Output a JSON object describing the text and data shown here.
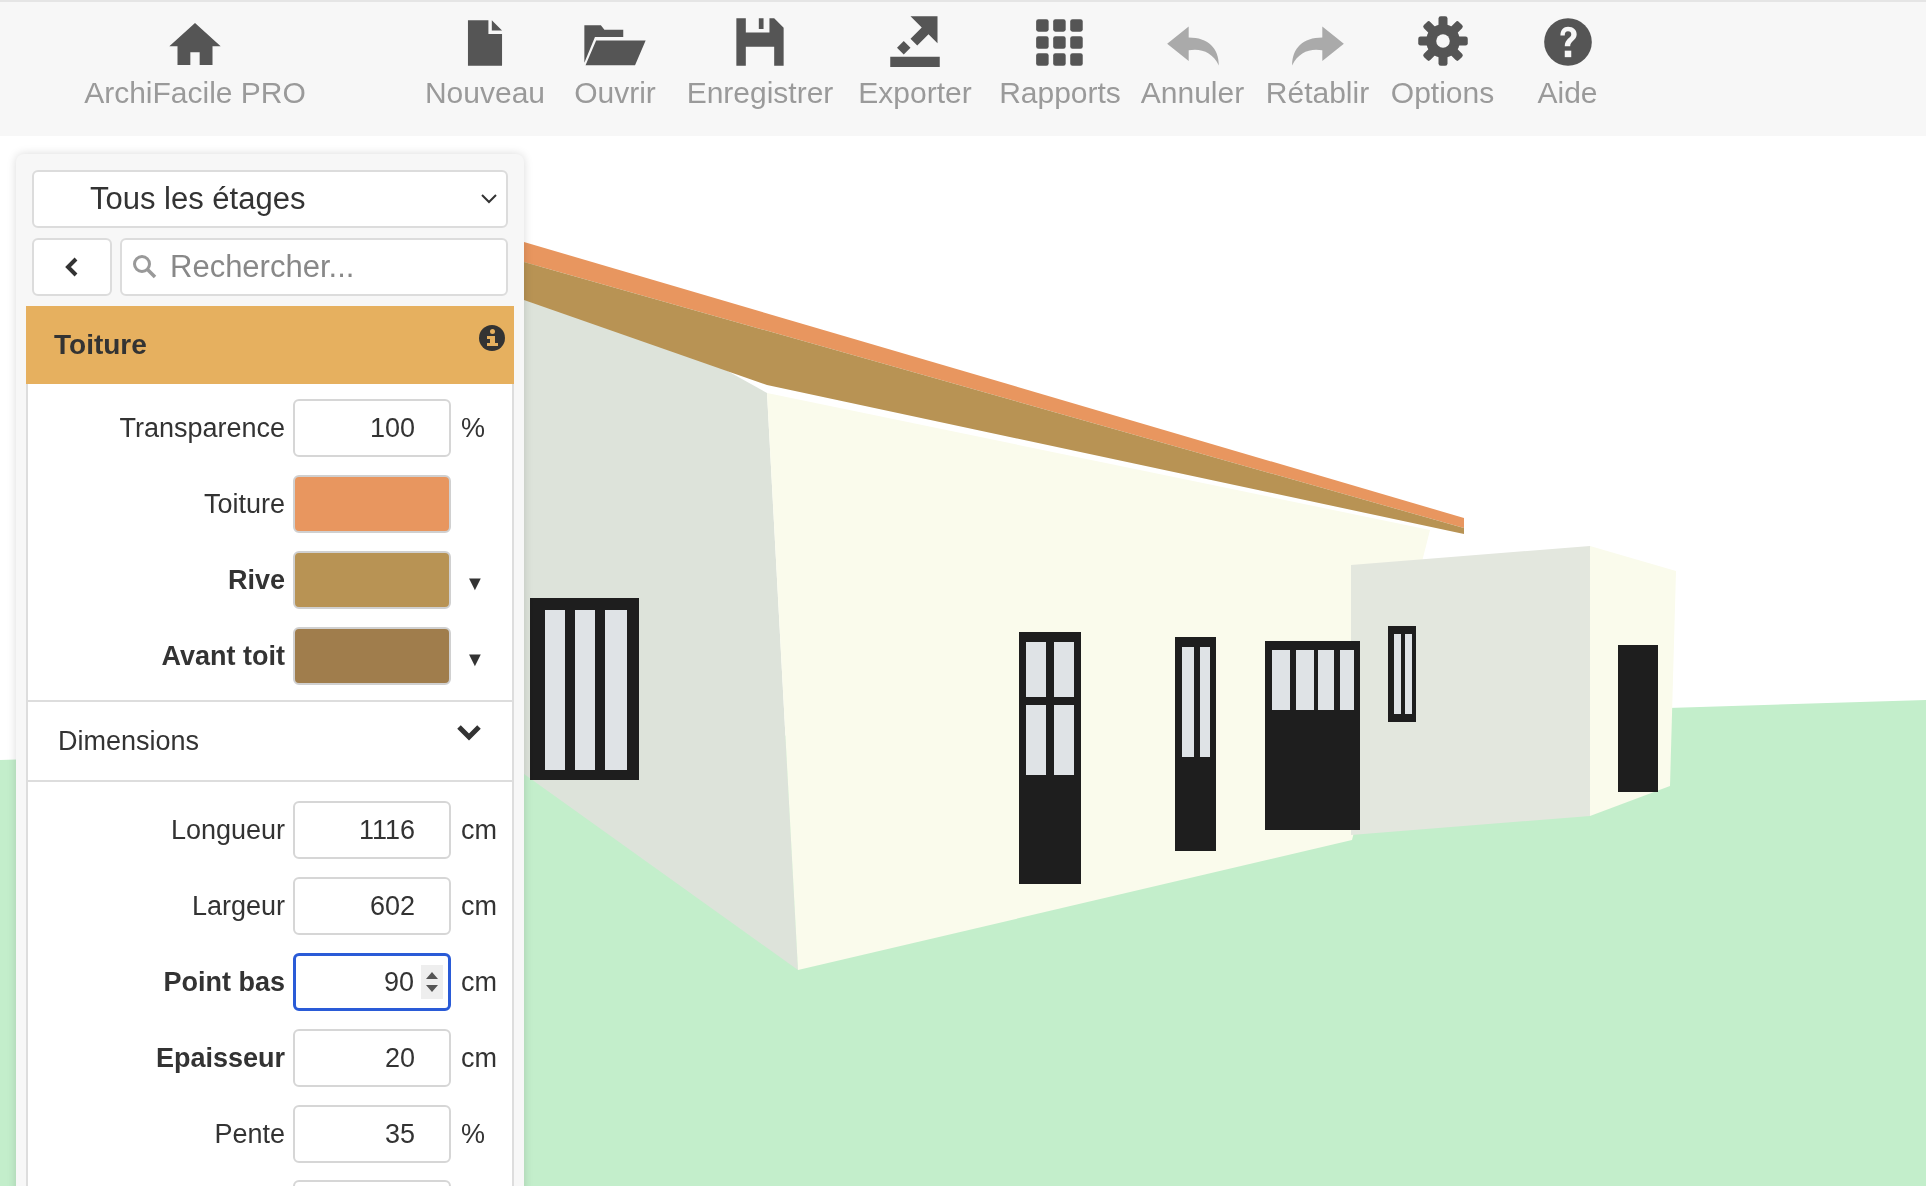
{
  "toolbar": {
    "items": [
      {
        "label": "ArchiFacile PRO",
        "disabled": false
      },
      {
        "label": "Nouveau",
        "disabled": false
      },
      {
        "label": "Ouvrir",
        "disabled": false
      },
      {
        "label": "Enregistrer",
        "disabled": false
      },
      {
        "label": "Exporter",
        "disabled": false
      },
      {
        "label": "Rapports",
        "disabled": false
      },
      {
        "label": "Annuler",
        "disabled": true
      },
      {
        "label": "Rétablir",
        "disabled": true
      },
      {
        "label": "Options",
        "disabled": false
      },
      {
        "label": "Aide",
        "disabled": false
      }
    ]
  },
  "panel": {
    "floor_select": {
      "value": "Tous les étages"
    },
    "search": {
      "placeholder": "Rechercher..."
    },
    "section": {
      "title": "Toiture"
    },
    "properties": [
      {
        "kind": "number",
        "label": "Transparence",
        "bold": false,
        "value": "100",
        "unit": "%"
      },
      {
        "kind": "color",
        "label": "Toiture",
        "bold": false,
        "color": "#e8965f"
      },
      {
        "kind": "color",
        "label": "Rive",
        "bold": true,
        "color": "#b89354",
        "dropdown_mark": "▼"
      },
      {
        "kind": "color",
        "label": "Avant toit",
        "bold": true,
        "color": "#a07d4c",
        "dropdown_mark": "▼"
      }
    ],
    "dimensions": {
      "title": "Dimensions",
      "expanded": true,
      "fields": [
        {
          "label": "Longueur",
          "bold": false,
          "value": "1116",
          "unit": "cm",
          "focused": false
        },
        {
          "label": "Largeur",
          "bold": false,
          "value": "602",
          "unit": "cm",
          "focused": false
        },
        {
          "label": "Point bas",
          "bold": true,
          "value": "90",
          "unit": "cm",
          "focused": true
        },
        {
          "label": "Epaisseur",
          "bold": true,
          "value": "20",
          "unit": "cm",
          "focused": false
        },
        {
          "label": "Pente",
          "bold": false,
          "value": "35",
          "unit": "%",
          "focused": false
        }
      ]
    }
  }
}
